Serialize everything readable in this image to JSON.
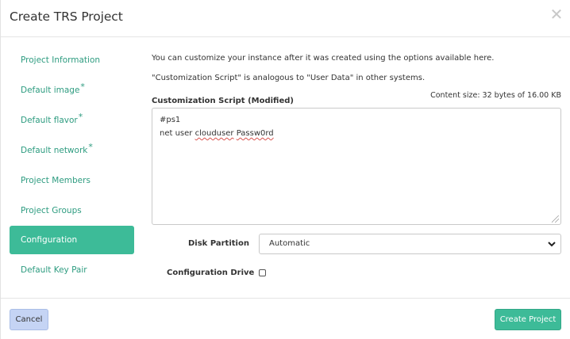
{
  "dialog": {
    "title": "Create TRS Project",
    "close_icon": "close-icon"
  },
  "sidebar": {
    "items": [
      {
        "label": "Project Information",
        "required": false,
        "active": false
      },
      {
        "label": "Default image",
        "required": true,
        "active": false
      },
      {
        "label": "Default flavor",
        "required": true,
        "active": false
      },
      {
        "label": "Default network",
        "required": true,
        "active": false
      },
      {
        "label": "Project Members",
        "required": false,
        "active": false
      },
      {
        "label": "Project Groups",
        "required": false,
        "active": false
      },
      {
        "label": "Configuration",
        "required": false,
        "active": true
      },
      {
        "label": "Default Key Pair",
        "required": false,
        "active": false
      }
    ],
    "required_marker": "*"
  },
  "configuration": {
    "help_text_1": "You can customize your instance after it was created using the options available here.",
    "help_text_2": "\"Customization Script\" is analogous to \"User Data\" in other systems.",
    "content_size": "Content size: 32 bytes of 16.00 KB",
    "script_label": "Customization Script (Modified)",
    "script_lines": {
      "line1": "#ps1",
      "line2_prefix": "net user ",
      "line2_word1": "clouduser",
      "line2_space": " ",
      "line2_word2": "Passw0rd"
    },
    "disk_partition_label": "Disk Partition",
    "disk_partition_value": "Automatic",
    "config_drive_label": "Configuration Drive",
    "config_drive_checked": false
  },
  "footer": {
    "cancel_label": "Cancel",
    "create_label": "Create Project"
  },
  "colors": {
    "accent": "#3dbb98",
    "link": "#2e9c80",
    "cancel_bg": "#c5d4f4"
  }
}
